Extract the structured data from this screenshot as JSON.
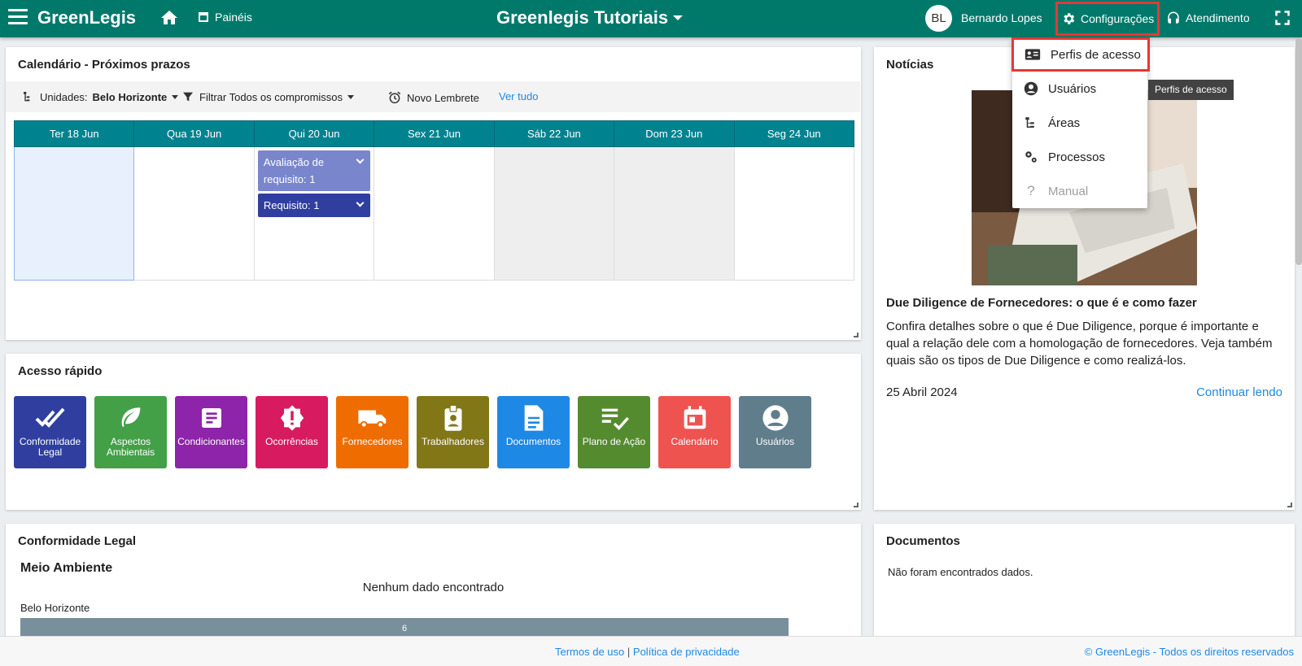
{
  "topbar": {
    "brand": "GreenLegis",
    "paineis": "Painéis",
    "center_title": "Greenlegis Tutoriais",
    "avatar_initials": "BL",
    "user_name": "Bernardo Lopes",
    "config": "Configurações",
    "atendimento": "Atendimento"
  },
  "calendar": {
    "title": "Calendário - Próximos prazos",
    "unidades_label": "Unidades:",
    "unidades_value": "Belo Horizonte",
    "filter_label": "Filtrar Todos os compromissos",
    "novo_lembrete": "Novo Lembrete",
    "ver_tudo": "Ver tudo",
    "days": [
      "Ter 18 Jun",
      "Qua 19 Jun",
      "Qui 20 Jun",
      "Sex 21 Jun",
      "Sáb 22 Jun",
      "Dom 23 Jun",
      "Seg 24 Jun"
    ],
    "events": [
      {
        "label": "Avaliação de requisito: 1",
        "color": "#7986cb"
      },
      {
        "label": "Requisito: 1",
        "color": "#303f9f"
      }
    ]
  },
  "quick_access": {
    "title": "Acesso rápido",
    "tiles": [
      {
        "label": "Conformidade Legal",
        "color": "#303f9f",
        "icon": "double-check-icon"
      },
      {
        "label": "Aspectos Ambientais",
        "color": "#43a047",
        "icon": "leaf-icon"
      },
      {
        "label": "Condicionantes",
        "color": "#8e24aa",
        "icon": "list-doc-icon"
      },
      {
        "label": "Ocorrências",
        "color": "#d81b60",
        "icon": "alert-badge-icon"
      },
      {
        "label": "Fornecedores",
        "color": "#ef6c00",
        "icon": "truck-icon"
      },
      {
        "label": "Trabalhadores",
        "color": "#827717",
        "icon": "id-badge-icon"
      },
      {
        "label": "Documentos",
        "color": "#1e88e5",
        "icon": "document-icon"
      },
      {
        "label": "Plano de Ação",
        "color": "#558b2f",
        "icon": "checklist-icon"
      },
      {
        "label": "Calendário",
        "color": "#ef5350",
        "icon": "calendar-icon"
      },
      {
        "label": "Usuários",
        "color": "#607d8b",
        "icon": "user-circle-icon"
      }
    ]
  },
  "news": {
    "title": "Notícias",
    "headline": "Due Diligence de Fornecedores: o que é e como fazer",
    "text": "Confira detalhes sobre o que é Due Diligence, porque é importante e qual a relação dele com a homologação de fornecedores. Veja também quais são os tipos de Due Diligence e como realizá-los.",
    "date": "25 Abril 2024",
    "more": "Continuar lendo"
  },
  "conformidade": {
    "title": "Conformidade Legal",
    "subtitle": "Meio Ambiente",
    "empty": "Nenhum dado encontrado",
    "row_label": "Belo Horizonte",
    "bar_value": "6"
  },
  "documentos": {
    "title": "Documentos",
    "empty": "Não foram encontrados dados."
  },
  "dropdown": {
    "items": [
      {
        "label": "Perfis de acesso",
        "icon": "id-card-icon"
      },
      {
        "label": "Usuários",
        "icon": "user-circle-icon"
      },
      {
        "label": "Áreas",
        "icon": "hierarchy-icon"
      },
      {
        "label": "Processos",
        "icon": "gears-icon"
      },
      {
        "label": "Manual",
        "icon": "question-icon"
      }
    ],
    "tooltip": "Perfis de acesso"
  },
  "footer": {
    "terms": "Termos de uso",
    "separator": "|",
    "privacy": "Política de privacidade",
    "copyright": "© GreenLegis - Todos os direitos reservados"
  }
}
